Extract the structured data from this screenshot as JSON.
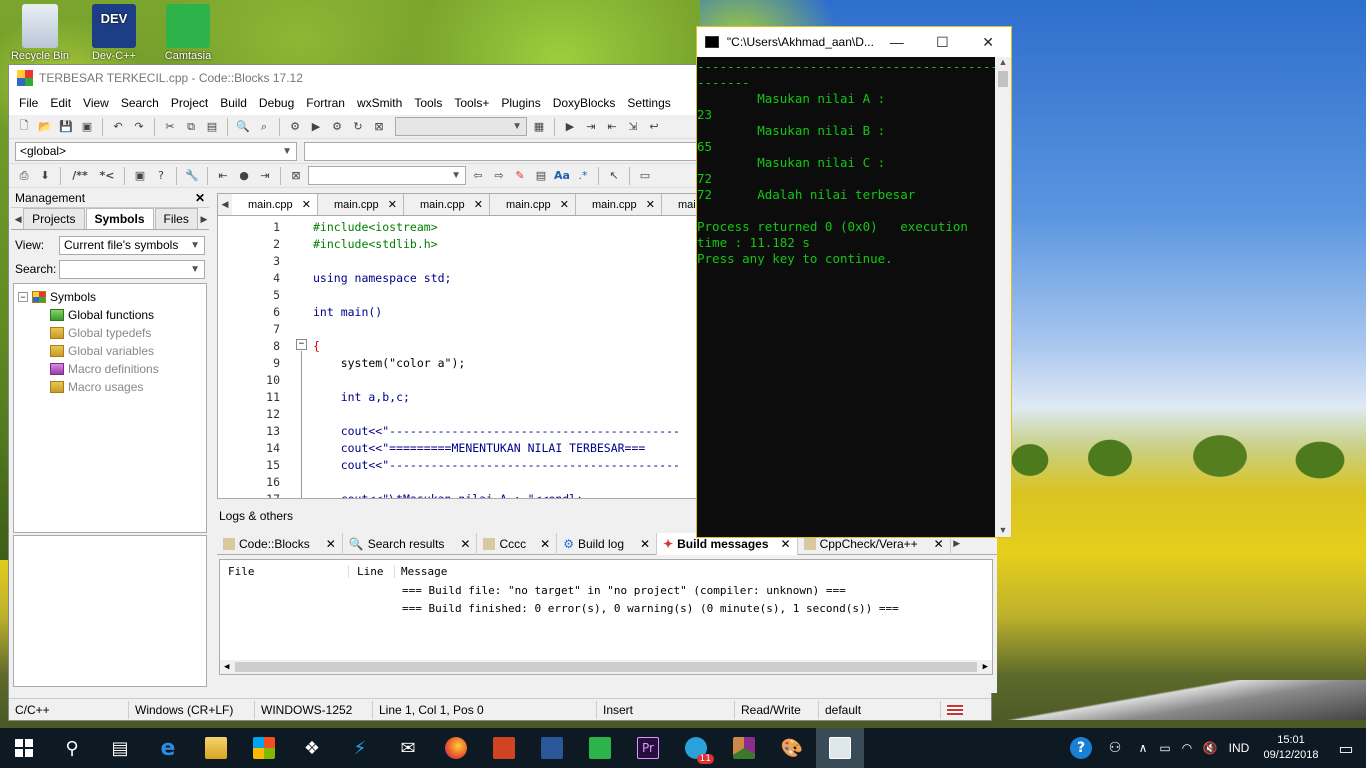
{
  "desktop": {
    "icons": [
      {
        "label": "Recycle Bin"
      },
      {
        "label": "Dev-C++"
      },
      {
        "label": "Camtasia"
      }
    ]
  },
  "codeblocks": {
    "title": "TERBESAR TERKECIL.cpp - Code::Blocks 17.12",
    "menu": [
      "File",
      "Edit",
      "View",
      "Search",
      "Project",
      "Build",
      "Debug",
      "Fortran",
      "wxSmith",
      "Tools",
      "Tools+",
      "Plugins",
      "DoxyBlocks",
      "Settings"
    ],
    "scope_combo": "<global>",
    "management": {
      "title": "Management",
      "tabs": [
        "Projects",
        "Symbols",
        "Files"
      ],
      "view_label": "View:",
      "view_value": "Current file's symbols",
      "search_label": "Search:",
      "tree": [
        "Symbols",
        "Global functions",
        "Global typedefs",
        "Global variables",
        "Macro definitions",
        "Macro usages"
      ]
    },
    "editor_tabs": [
      "main.cpp",
      "main.cpp",
      "main.cpp",
      "main.cpp",
      "main.cpp",
      "main.cpp"
    ],
    "code": [
      {
        "n": "1",
        "t": "#include<iostream>",
        "c": "pp"
      },
      {
        "n": "2",
        "t": "#include<stdlib.h>",
        "c": "pp"
      },
      {
        "n": "3",
        "t": "",
        "c": ""
      },
      {
        "n": "4",
        "t": "using namespace std;",
        "c": "kw"
      },
      {
        "n": "5",
        "t": "",
        "c": ""
      },
      {
        "n": "6",
        "t": "int main()",
        "c": "kw"
      },
      {
        "n": "7",
        "t": "",
        "c": ""
      },
      {
        "n": "8",
        "t": "{",
        "c": "op"
      },
      {
        "n": "9",
        "t": "    system(\"color a\");",
        "c": ""
      },
      {
        "n": "10",
        "t": "",
        "c": ""
      },
      {
        "n": "11",
        "t": "    int a,b,c;",
        "c": "kw"
      },
      {
        "n": "12",
        "t": "",
        "c": ""
      },
      {
        "n": "13",
        "t": "    cout<<\"------------------------------------------",
        "c": "str"
      },
      {
        "n": "14",
        "t": "    cout<<\"=========MENENTUKAN NILAI TERBESAR===",
        "c": "str"
      },
      {
        "n": "15",
        "t": "    cout<<\"------------------------------------------",
        "c": "str"
      },
      {
        "n": "16",
        "t": "",
        "c": ""
      },
      {
        "n": "17",
        "t": "    cout<<\"\\tMasukan nilai A : \"<<endl;",
        "c": "str"
      }
    ],
    "logs": {
      "title": "Logs & others",
      "tabs": [
        "Code::Blocks",
        "Search results",
        "Cccc",
        "Build log",
        "Build messages",
        "CppCheck/Vera++"
      ],
      "columns": [
        "File",
        "Line",
        "Message"
      ],
      "messages": [
        "=== Build file: \"no target\" in \"no project\" (compiler: unknown) ===",
        "=== Build finished: 0 error(s), 0 warning(s) (0 minute(s), 1 second(s)) ==="
      ]
    },
    "status": [
      "C/C++",
      "Windows (CR+LF)",
      "WINDOWS-1252",
      "Line 1, Col 1, Pos 0",
      "Insert",
      "Read/Write",
      "default"
    ]
  },
  "console": {
    "title": "\"C:\\Users\\Akhmad_aan\\D...",
    "lines": [
      "------------------------------------------",
      "-------",
      "        Masukan nilai A :",
      "23",
      "        Masukan nilai B :",
      "65",
      "        Masukan nilai C :",
      "72",
      "72      Adalah nilai terbesar",
      "",
      "Process returned 0 (0x0)   execution",
      "time : 11.182 s",
      "Press any key to continue."
    ]
  },
  "taskbar": {
    "lang": "IND",
    "time": "15:01",
    "date": "09/12/2018",
    "badge": "11"
  }
}
